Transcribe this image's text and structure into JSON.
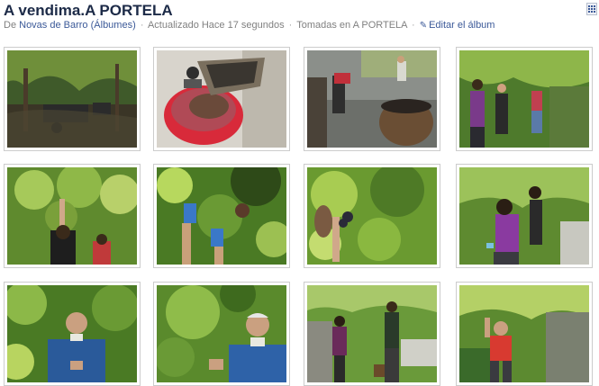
{
  "album": {
    "title": "A vendima.A PORTELA",
    "by_prefix": "De",
    "author": "Novas de Barro",
    "albums_link": "(Álbumes)",
    "updated": "Actualizado Hace 17 segundos",
    "location": "Tomadas en A PORTELA",
    "edit": "Editar el álbum"
  },
  "icons": {
    "edit": "pencil-icon",
    "view_toggle": "grid-view-icon"
  },
  "colors": {
    "link": "#3b5998",
    "title": "#1c2a47",
    "meta": "#808080"
  },
  "photos": [
    {
      "id": 1,
      "scene": "vineyard-wheelbarrow"
    },
    {
      "id": 2,
      "scene": "grape-crusher-bucket"
    },
    {
      "id": 3,
      "scene": "courtyard-barrels"
    },
    {
      "id": 4,
      "scene": "pickers-in-rows"
    },
    {
      "id": 5,
      "scene": "woman-reaching-vines"
    },
    {
      "id": 6,
      "scene": "hands-with-gloves"
    },
    {
      "id": 7,
      "scene": "picking-grapes-closeup"
    },
    {
      "id": 8,
      "scene": "woman-picking"
    },
    {
      "id": 9,
      "scene": "man-blue-jacket"
    },
    {
      "id": 10,
      "scene": "older-man-smiling"
    },
    {
      "id": 11,
      "scene": "women-in-vineyard"
    },
    {
      "id": 12,
      "scene": "child-red-shirt"
    }
  ]
}
